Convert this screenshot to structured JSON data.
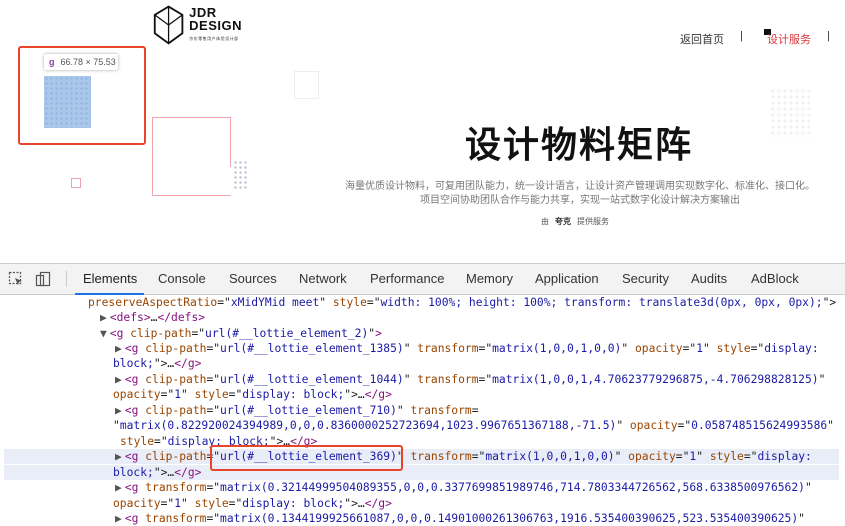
{
  "page": {
    "logo": {
      "line1": "JDR",
      "line2": "DESIGN",
      "tagline": "京东零售用户体验设计部"
    },
    "nav": {
      "home": "返回首页",
      "separator": "|",
      "services": "设计服务"
    },
    "hero": {
      "title": "设计物料矩阵",
      "desc1": "海量优质设计物料，可复用团队能力，统一设计语言，让设计资产管理调用实现数字化、标准化、接口化。",
      "desc2": "项目空间协助团队合作与能力共享，实现一站式数字化设计解决方案输出",
      "by_prefix": "由",
      "by_name": "夸克",
      "by_suffix": "提供服务"
    },
    "tooltip": {
      "tag": "g",
      "size": "66.78 × 75.53"
    }
  },
  "devtools": {
    "tabs": [
      "Elements",
      "Console",
      "Sources",
      "Network",
      "Performance",
      "Memory",
      "Application",
      "Security",
      "Audits",
      "AdBlock"
    ],
    "selected_tab": "Elements",
    "lines": [
      {
        "indent": 88,
        "parts": [
          [
            "attr",
            "preserveAspectRatio"
          ],
          [
            "txt",
            "=\""
          ],
          [
            "val",
            "xMidYMid meet"
          ],
          [
            "txt",
            "\" "
          ],
          [
            "attr",
            "style"
          ],
          [
            "txt",
            "=\""
          ],
          [
            "val",
            "width: 100%; height: 100%; transform: translate3d(0px, 0px, 0px);"
          ],
          [
            "txt",
            "\">"
          ]
        ]
      },
      {
        "indent": 100,
        "parts": [
          [
            "tri",
            "▶"
          ],
          [
            "tag",
            "<defs>"
          ],
          [
            "txt",
            "…"
          ],
          [
            "tag",
            "</defs>"
          ]
        ]
      },
      {
        "indent": 100,
        "parts": [
          [
            "tri",
            "▼"
          ],
          [
            "tag",
            "<g "
          ],
          [
            "attr",
            "clip-path"
          ],
          [
            "txt",
            "=\""
          ],
          [
            "val",
            "url(#__lottie_element_2)"
          ],
          [
            "txt",
            "\""
          ],
          [
            "tag",
            ">"
          ]
        ]
      },
      {
        "indent": 115,
        "parts": [
          [
            "tri",
            "▶"
          ],
          [
            "tag",
            "<g "
          ],
          [
            "attr",
            "clip-path"
          ],
          [
            "txt",
            "=\""
          ],
          [
            "val",
            "url(#__lottie_element_1385)"
          ],
          [
            "txt",
            "\" "
          ],
          [
            "attr",
            "transform"
          ],
          [
            "txt",
            "=\""
          ],
          [
            "val",
            "matrix(1,0,0,1,0,0)"
          ],
          [
            "txt",
            "\" "
          ],
          [
            "attr",
            "opacity"
          ],
          [
            "txt",
            "=\""
          ],
          [
            "val",
            "1"
          ],
          [
            "txt",
            "\" "
          ],
          [
            "attr",
            "style"
          ],
          [
            "txt",
            "=\""
          ],
          [
            "val",
            "display:"
          ]
        ]
      },
      {
        "indent": 113,
        "parts": [
          [
            "val",
            "block;"
          ],
          [
            "txt",
            "\">…"
          ],
          [
            "tag",
            "</g>"
          ]
        ]
      },
      {
        "indent": 115,
        "parts": [
          [
            "tri",
            "▶"
          ],
          [
            "tag",
            "<g "
          ],
          [
            "attr",
            "clip-path"
          ],
          [
            "txt",
            "=\""
          ],
          [
            "val",
            "url(#__lottie_element_1044)"
          ],
          [
            "txt",
            "\" "
          ],
          [
            "attr",
            "transform"
          ],
          [
            "txt",
            "=\""
          ],
          [
            "val",
            "matrix(1,0,0,1,4.70623779296875,-4.706298828125)"
          ],
          [
            "txt",
            "\""
          ]
        ]
      },
      {
        "indent": 113,
        "parts": [
          [
            "attr",
            "opacity"
          ],
          [
            "txt",
            "=\""
          ],
          [
            "val",
            "1"
          ],
          [
            "txt",
            "\" "
          ],
          [
            "attr",
            "style"
          ],
          [
            "txt",
            "=\""
          ],
          [
            "val",
            "display: block;"
          ],
          [
            "txt",
            "\">…"
          ],
          [
            "tag",
            "</g>"
          ]
        ]
      },
      {
        "indent": 115,
        "parts": [
          [
            "tri",
            "▶"
          ],
          [
            "tag",
            "<g "
          ],
          [
            "attr",
            "clip-path"
          ],
          [
            "txt",
            "=\""
          ],
          [
            "val",
            "url(#__lottie_element_710)"
          ],
          [
            "txt",
            "\" "
          ],
          [
            "attr",
            "transform"
          ],
          [
            "txt",
            "="
          ]
        ]
      },
      {
        "indent": 113,
        "parts": [
          [
            "txt",
            "\""
          ],
          [
            "val",
            "matrix(0.822920024394989,0,0,0.8360000252723694,1023.9967651367188,-71.5)"
          ],
          [
            "txt",
            "\" "
          ],
          [
            "attr",
            "opacity"
          ],
          [
            "txt",
            "=\""
          ],
          [
            "val",
            "0.058748515624993586"
          ],
          [
            "txt",
            "\""
          ]
        ]
      },
      {
        "indent": 120,
        "parts": [
          [
            "attr",
            "style"
          ],
          [
            "txt",
            "=\""
          ],
          [
            "val",
            "display: block;"
          ],
          [
            "txt",
            "\">…"
          ],
          [
            "tag",
            "</g>"
          ]
        ]
      },
      {
        "indent": 115,
        "hl": true,
        "parts": [
          [
            "tri",
            "▶"
          ],
          [
            "tag",
            "<g "
          ],
          [
            "attr",
            "clip-path"
          ],
          [
            "txt",
            "=\""
          ],
          [
            "val",
            "url(#__lottie_element_369)"
          ],
          [
            "txt",
            "\" "
          ],
          [
            "attr",
            "transform"
          ],
          [
            "txt",
            "=\""
          ],
          [
            "val",
            "matrix(1,0,0,1,0,0)"
          ],
          [
            "txt",
            "\" "
          ],
          [
            "attr",
            "opacity"
          ],
          [
            "txt",
            "=\""
          ],
          [
            "val",
            "1"
          ],
          [
            "txt",
            "\" "
          ],
          [
            "attr",
            "style"
          ],
          [
            "txt",
            "=\""
          ],
          [
            "val",
            "display:"
          ]
        ]
      },
      {
        "indent": 113,
        "hl": true,
        "parts": [
          [
            "val",
            "block;"
          ],
          [
            "txt",
            "\">…"
          ],
          [
            "tag",
            "</g>"
          ]
        ]
      },
      {
        "indent": 115,
        "parts": [
          [
            "tri",
            "▶"
          ],
          [
            "tag",
            "<g "
          ],
          [
            "attr",
            "transform"
          ],
          [
            "txt",
            "=\""
          ],
          [
            "val",
            "matrix(0.32144999504089355,0,0,0.3377699851989746,714.7803344726562,568.6338500976562)"
          ],
          [
            "txt",
            "\""
          ]
        ]
      },
      {
        "indent": 113,
        "parts": [
          [
            "attr",
            "opacity"
          ],
          [
            "txt",
            "=\""
          ],
          [
            "val",
            "1"
          ],
          [
            "txt",
            "\" "
          ],
          [
            "attr",
            "style"
          ],
          [
            "txt",
            "=\""
          ],
          [
            "val",
            "display: block;"
          ],
          [
            "txt",
            "\">…"
          ],
          [
            "tag",
            "</g>"
          ]
        ]
      },
      {
        "indent": 115,
        "parts": [
          [
            "tri",
            "▶"
          ],
          [
            "tag",
            "<g "
          ],
          [
            "attr",
            "transform"
          ],
          [
            "txt",
            "=\""
          ],
          [
            "val",
            "matrix(0.1344199925661087,0,0,0.14901000261306763,1916.535400390625,523.535400390625)"
          ],
          [
            "txt",
            "\""
          ]
        ]
      }
    ]
  }
}
